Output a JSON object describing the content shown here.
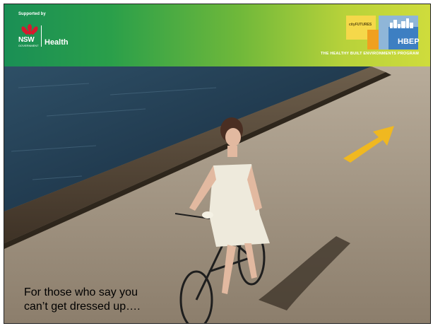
{
  "header": {
    "supported_by": "Supported by",
    "nsw_wordmark": "NSW",
    "nsw_government": "GOVERNMENT",
    "health": "Health",
    "cityfutures": "cityFUTURES",
    "hbep": "HBEP",
    "tagline": "THE HEALTHY BUILT ENVIRONMENTS PROGRAM"
  },
  "caption": {
    "line1": "For those who say you",
    "line2": "can’t get dressed up…."
  },
  "colors": {
    "header_start": "#1a8f55",
    "header_end": "#cfdc3c",
    "water": "#1e3a52",
    "path": "#a89a86",
    "arrow": "#f0b820"
  },
  "icons": [
    "waratah-icon",
    "bicycle-icon",
    "arrow-icon"
  ]
}
